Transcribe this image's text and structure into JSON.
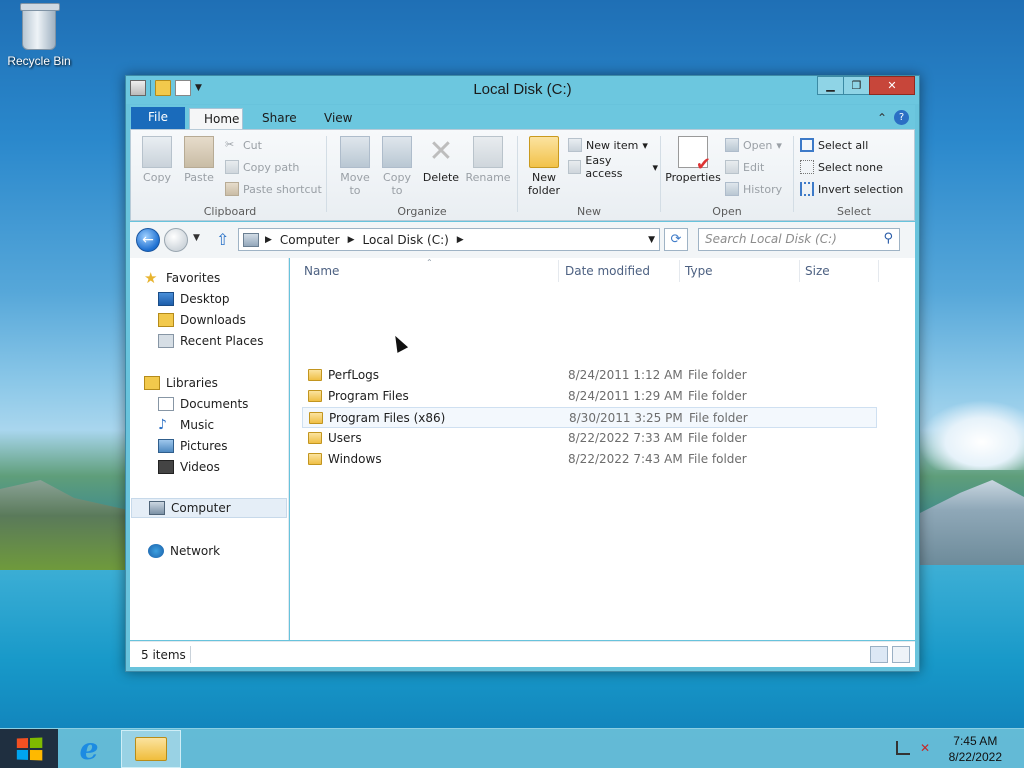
{
  "desktop": {
    "recycle_bin_label": "Recycle Bin"
  },
  "window": {
    "title": "Local Disk (C:)"
  },
  "ribbon": {
    "tabs": [
      "File",
      "Home",
      "Share",
      "View"
    ],
    "clipboard": {
      "copy": "Copy",
      "paste": "Paste",
      "cut": "Cut",
      "copy_path": "Copy path",
      "paste_shortcut": "Paste shortcut",
      "label": "Clipboard"
    },
    "organize": {
      "move_to": "Move to",
      "copy_to": "Copy to",
      "delete": "Delete",
      "rename": "Rename",
      "label": "Organize"
    },
    "new": {
      "new_folder": "New folder",
      "new_item": "New item",
      "easy_access": "Easy access",
      "label": "New"
    },
    "open": {
      "properties": "Properties",
      "open": "Open",
      "edit": "Edit",
      "history": "History",
      "label": "Open"
    },
    "select": {
      "select_all": "Select all",
      "select_none": "Select none",
      "invert_selection": "Invert selection",
      "label": "Select"
    }
  },
  "address": {
    "crumbs": [
      "Computer",
      "Local Disk (C:)"
    ],
    "search_placeholder": "Search Local Disk (C:)"
  },
  "nav_pane": {
    "favorites": "Favorites",
    "favorites_items": [
      "Desktop",
      "Downloads",
      "Recent Places"
    ],
    "libraries": "Libraries",
    "libraries_items": [
      "Documents",
      "Music",
      "Pictures",
      "Videos"
    ],
    "computer": "Computer",
    "network": "Network"
  },
  "columns": [
    "Name",
    "Date modified",
    "Type",
    "Size"
  ],
  "files": [
    {
      "name": "PerfLogs",
      "date": "8/24/2011 1:12 AM",
      "type": "File folder"
    },
    {
      "name": "Program Files",
      "date": "8/24/2011 1:29 AM",
      "type": "File folder"
    },
    {
      "name": "Program Files (x86)",
      "date": "8/30/2011 3:25 PM",
      "type": "File folder"
    },
    {
      "name": "Users",
      "date": "8/22/2022 7:33 AM",
      "type": "File folder"
    },
    {
      "name": "Windows",
      "date": "8/22/2022 7:43 AM",
      "type": "File folder"
    }
  ],
  "status": {
    "item_count": "5 items"
  },
  "taskbar": {
    "time": "7:45 AM",
    "date": "8/22/2022"
  }
}
